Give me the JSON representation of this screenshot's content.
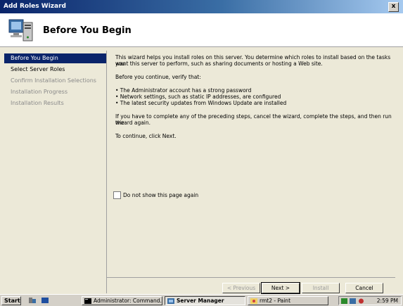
{
  "window": {
    "title": "Add Roles Wizard",
    "close_label": "x"
  },
  "header": {
    "title": "Before You Begin"
  },
  "nav": {
    "items": [
      {
        "label": "Before You Begin"
      },
      {
        "label": "Select Server Roles"
      },
      {
        "label": "Confirm Installation Selections"
      },
      {
        "label": "Installation Progress"
      },
      {
        "label": "Installation Results"
      }
    ]
  },
  "main": {
    "intro_line1": "This wizard helps you install roles on this server. You determine which roles to install based on the tasks you",
    "intro_line2": "want this server to perform, such as sharing documents or hosting a Web site.",
    "verify": "Before you continue, verify that:",
    "bullets": [
      "• The Administrator account has a strong password",
      "• Network settings, such as static IP addresses, are configured",
      "• The latest security updates from Windows Update are installed"
    ],
    "cancel_line1": "If you have to complete any of the preceding steps, cancel the wizard, complete the steps, and then run the",
    "cancel_line2": "wizard again.",
    "continue": "To continue, click Next.",
    "checkbox_label": "Do not show this page again"
  },
  "buttons": {
    "previous": "< Previous",
    "next": "Next >",
    "install": "Install",
    "cancel": "Cancel"
  },
  "taskbar": {
    "start": "Start",
    "tasks": [
      {
        "label": "Administrator: Command..."
      },
      {
        "label": "Server Manager"
      },
      {
        "label": "rmt2 - Paint"
      }
    ],
    "clock": "2:59 PM"
  },
  "colors": {
    "accent": "#0a246a",
    "face": "#ece9d8"
  }
}
